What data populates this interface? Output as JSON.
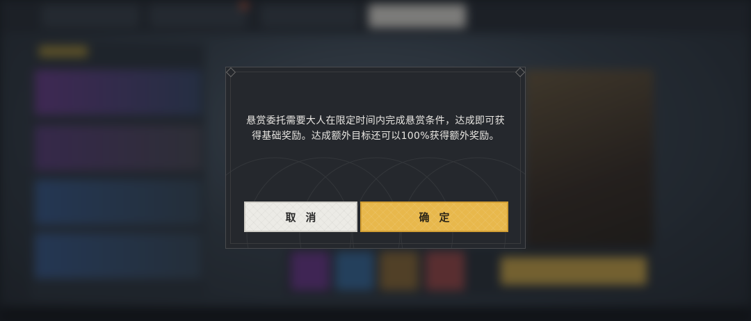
{
  "dialog": {
    "message_line1": "悬赏委托需要大人在限定时间内完成悬赏条件，达成即可获",
    "message_line2": "得基础奖励。达成额外目标还可以100%获得额外奖励。",
    "cancel_label": "取消",
    "confirm_label": "确定"
  },
  "colors": {
    "dialog_bg": "#25282d",
    "cancel_bg": "#ecebe6",
    "confirm_bg": "#e8b84c",
    "text": "#e8e6e2"
  }
}
